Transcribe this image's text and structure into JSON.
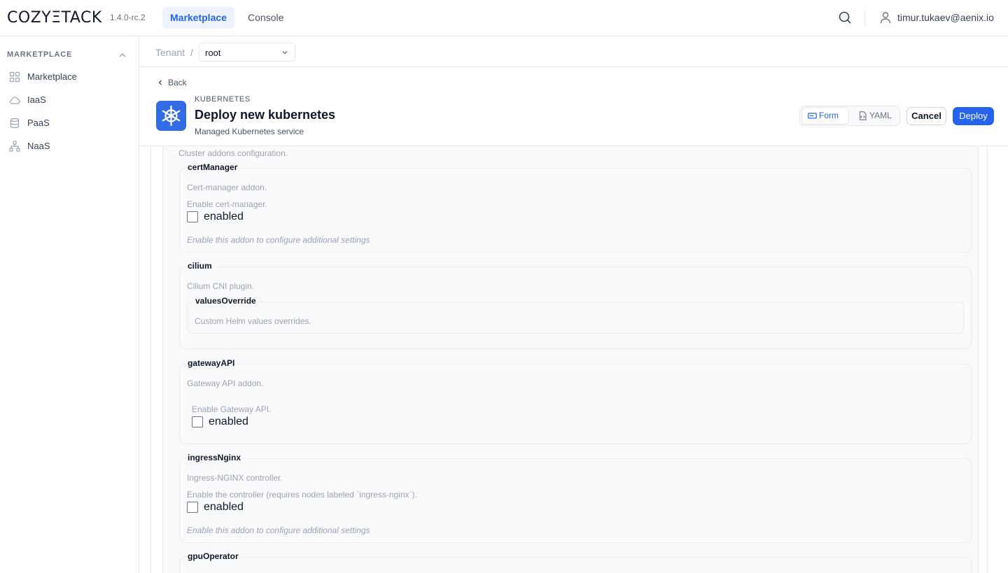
{
  "app": {
    "logo": "COZYΞTACK",
    "version": "1.4.0-rc.2",
    "nav_tabs": [
      {
        "label": "Marketplace",
        "active": true
      },
      {
        "label": "Console",
        "active": false
      }
    ],
    "user_email": "timur.tukaev@aenix.io"
  },
  "sidebar": {
    "heading": "MARKETPLACE",
    "items": [
      {
        "label": "Marketplace",
        "icon": "grid-icon"
      },
      {
        "label": "IaaS",
        "icon": "cloud-icon"
      },
      {
        "label": "PaaS",
        "icon": "database-icon"
      },
      {
        "label": "NaaS",
        "icon": "network-icon"
      }
    ]
  },
  "breadcrumb": {
    "tenant_label": "Tenant",
    "separator": "/",
    "tenant_value": "root"
  },
  "header": {
    "back_label": "Back",
    "kind": "KUBERNETES",
    "title": "Deploy new kubernetes",
    "subtitle": "Managed Kubernetes service",
    "mode_form": "Form",
    "mode_yaml": "YAML",
    "cancel_label": "Cancel",
    "deploy_label": "Deploy",
    "accent_color": "#2563eb",
    "icon_color": "#326ce5"
  },
  "form": {
    "addons_description": "Cluster addons configuration.",
    "cert_manager": {
      "legend": "certManager",
      "description": "Cert-manager addon.",
      "field_description": "Enable cert-manager.",
      "checkbox_label": "enabled",
      "checked": false,
      "hint": "Enable this addon to configure additional settings"
    },
    "cilium": {
      "legend": "cilium",
      "description": "Cilium CNI plugin.",
      "values_override": {
        "legend": "valuesOverride",
        "description": "Custom Helm values overrides."
      }
    },
    "gateway_api": {
      "legend": "gatewayAPI",
      "description": "Gateway API addon.",
      "field_description": "Enable Gateway API.",
      "checkbox_label": "enabled",
      "checked": false
    },
    "ingress_nginx": {
      "legend": "ingressNginx",
      "description": "Ingress-NGINX controller.",
      "field_description": "Enable the controller (requires nodes labeled `ingress-nginx`).",
      "checkbox_label": "enabled",
      "checked": false,
      "hint": "Enable this addon to configure additional settings"
    },
    "gpu_operator": {
      "legend": "gpuOperator"
    }
  }
}
